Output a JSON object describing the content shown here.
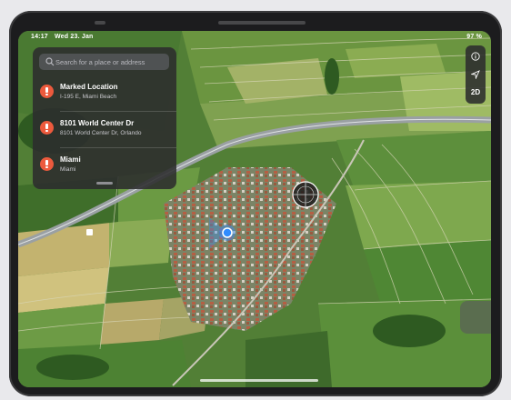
{
  "status": {
    "time": "14:17",
    "date": "Wed 23. Jan",
    "battery": "97 %"
  },
  "search": {
    "placeholder": "Search for a place or address"
  },
  "results": [
    {
      "title": "Marked Location",
      "subtitle": "I-195 E, Miami Beach"
    },
    {
      "title": "8101 World Center Dr",
      "subtitle": "8101 World Center Dr, Orlando"
    },
    {
      "title": "Miami",
      "subtitle": "Miami"
    }
  ],
  "map_controls": {
    "info_icon": "info-icon",
    "location_icon": "location-arrow-icon",
    "mode_label": "2D"
  },
  "icons": {
    "search": "search-icon",
    "pin": "pin-icon",
    "compass": "compass-icon",
    "user_location": "user-location-icon"
  },
  "colors": {
    "accent_blue": "#2f8cff",
    "pin_red": "#ec5a3d",
    "panel": "#2c2c2e"
  }
}
